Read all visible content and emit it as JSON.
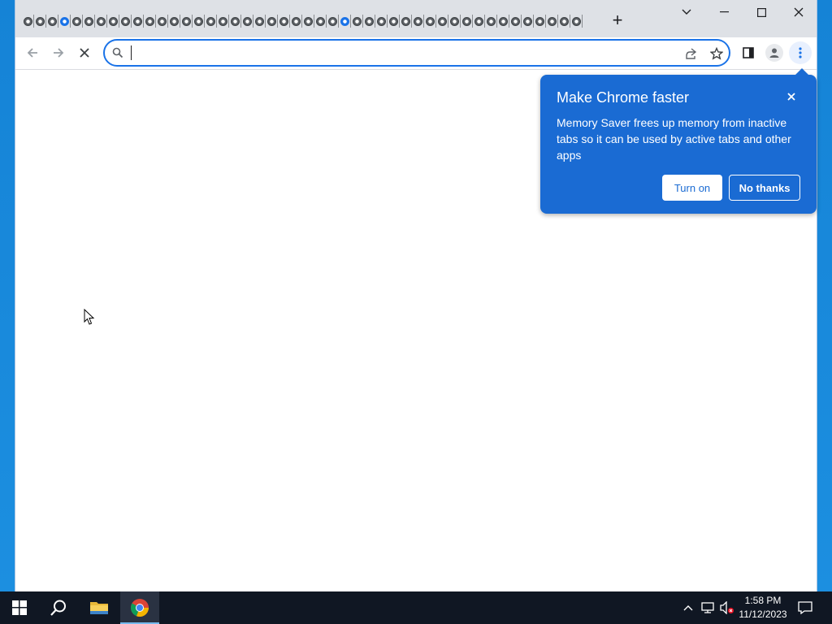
{
  "browser": {
    "tab_count": 46,
    "loading_tab_indexes": [
      3,
      26
    ],
    "new_tab_label": "+",
    "omnibox": {
      "value": "",
      "placeholder": ""
    }
  },
  "popup": {
    "title": "Make Chrome faster",
    "body": "Memory Saver frees up memory from inactive tabs so it can be used by active tabs and other apps",
    "primary_button": "Turn on",
    "secondary_button": "No thanks"
  },
  "taskbar": {
    "time": "1:58 PM",
    "date": "11/12/2023"
  },
  "icons": [
    "search-icon",
    "back-icon",
    "forward-icon",
    "stop-icon",
    "share-icon",
    "star-icon",
    "side-panel-icon",
    "profile-icon",
    "menu-icon",
    "windows-icon",
    "file-explorer-icon",
    "chrome-icon"
  ],
  "colors": {
    "accent": "#1a73e8",
    "popup_bg": "#1a6bd3",
    "taskbar": "#101723"
  }
}
